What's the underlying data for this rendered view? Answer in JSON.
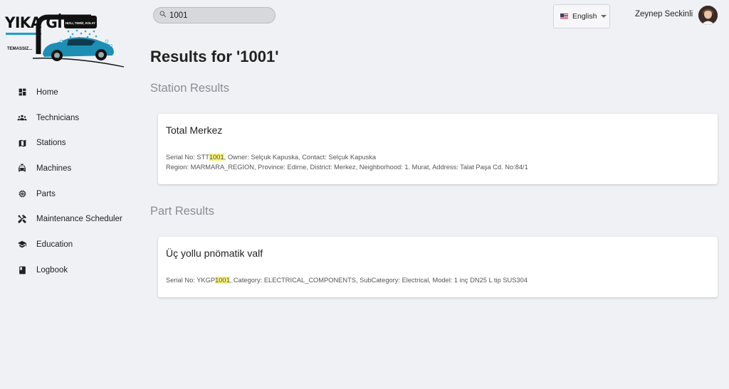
{
  "app": {
    "logo_text": "YIKA GİT",
    "logo_tagline": "TEMASSIZ...",
    "logo_sign": "HIZLI, TEMİZ, KOLAY"
  },
  "sidebar": {
    "items": [
      {
        "label": "Home",
        "icon": "dashboard-icon"
      },
      {
        "label": "Technicians",
        "icon": "groups-icon"
      },
      {
        "label": "Stations",
        "icon": "map-icon"
      },
      {
        "label": "Machines",
        "icon": "car-icon"
      },
      {
        "label": "Parts",
        "icon": "memory-chip-icon"
      },
      {
        "label": "Maintenance Scheduler",
        "icon": "tools-icon"
      },
      {
        "label": "Education",
        "icon": "school-cap-icon"
      },
      {
        "label": "Logbook",
        "icon": "book-icon"
      }
    ]
  },
  "search": {
    "value": "1001",
    "placeholder": ""
  },
  "language": {
    "selected": "English",
    "flag": "us-flag-icon"
  },
  "user": {
    "name": "Zeynep Seckinli"
  },
  "page": {
    "title": "Results for '1001'"
  },
  "highlight_color": "#f7f27a",
  "station_results": {
    "heading": "Station Results",
    "items": [
      {
        "title": "Total Merkez",
        "serial_prefix": "Serial No: STT",
        "serial_match": "1001",
        "line1_rest": ", Owner: Selçuk Kapuska, Contact: Selçuk Kapuska",
        "line2": "Region: MARMARA_REGION, Province: Edirne, District: Merkez, Neighborhood: 1. Murat, Address: Talat Paşa Cd. No:84/1"
      }
    ]
  },
  "part_results": {
    "heading": "Part Results",
    "items": [
      {
        "title": "Üç yollu pnömatik valf",
        "serial_prefix": "Serial No: YKGP",
        "serial_match": "1001",
        "line1_rest": ", Category: ELECTRICAL_COMPONENTS, SubCategory: Electrical, Model: 1 inç DN25 L tip SUS304"
      }
    ]
  }
}
